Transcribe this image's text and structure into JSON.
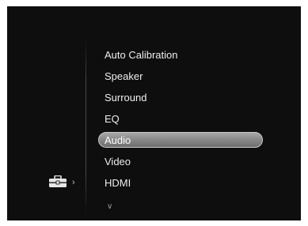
{
  "menu": {
    "items": [
      {
        "label": "Auto Calibration"
      },
      {
        "label": "Speaker"
      },
      {
        "label": "Surround"
      },
      {
        "label": "EQ"
      },
      {
        "label": "Audio",
        "selected": true
      },
      {
        "label": "Video"
      },
      {
        "label": "HDMI"
      }
    ],
    "more_indicator": "∨"
  },
  "category": {
    "icon": "toolbox-icon",
    "arrow": "›"
  }
}
